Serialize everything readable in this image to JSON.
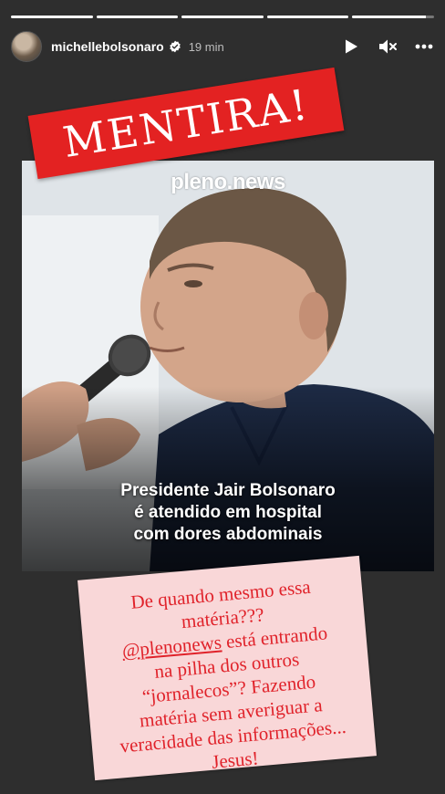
{
  "header": {
    "username": "michellebolsonaro",
    "time": "19 min",
    "verified": true
  },
  "progress": {
    "segments": 5,
    "current_index": 4,
    "current_fraction": 0.9
  },
  "story": {
    "stamp": "MENTIRA!",
    "news_brand": "pleno.news",
    "headline_lines": [
      "Presidente Jair Bolsonaro",
      "é atendido em hospital",
      "com dores abdominais"
    ],
    "caption_lines": [
      "De quando mesmo essa",
      "matéria???",
      "@plenonews está entrando",
      "na pilha dos outros",
      "“jornalecos”? Fazendo",
      "matéria sem averiguar a",
      "veracidade das informações...",
      "Jesus!"
    ],
    "mention": "@plenonews",
    "mention_rest": " está entrando"
  },
  "colors": {
    "stamp": "#e32222",
    "note_bg": "#f9d7d8",
    "note_text": "#e0222a"
  }
}
